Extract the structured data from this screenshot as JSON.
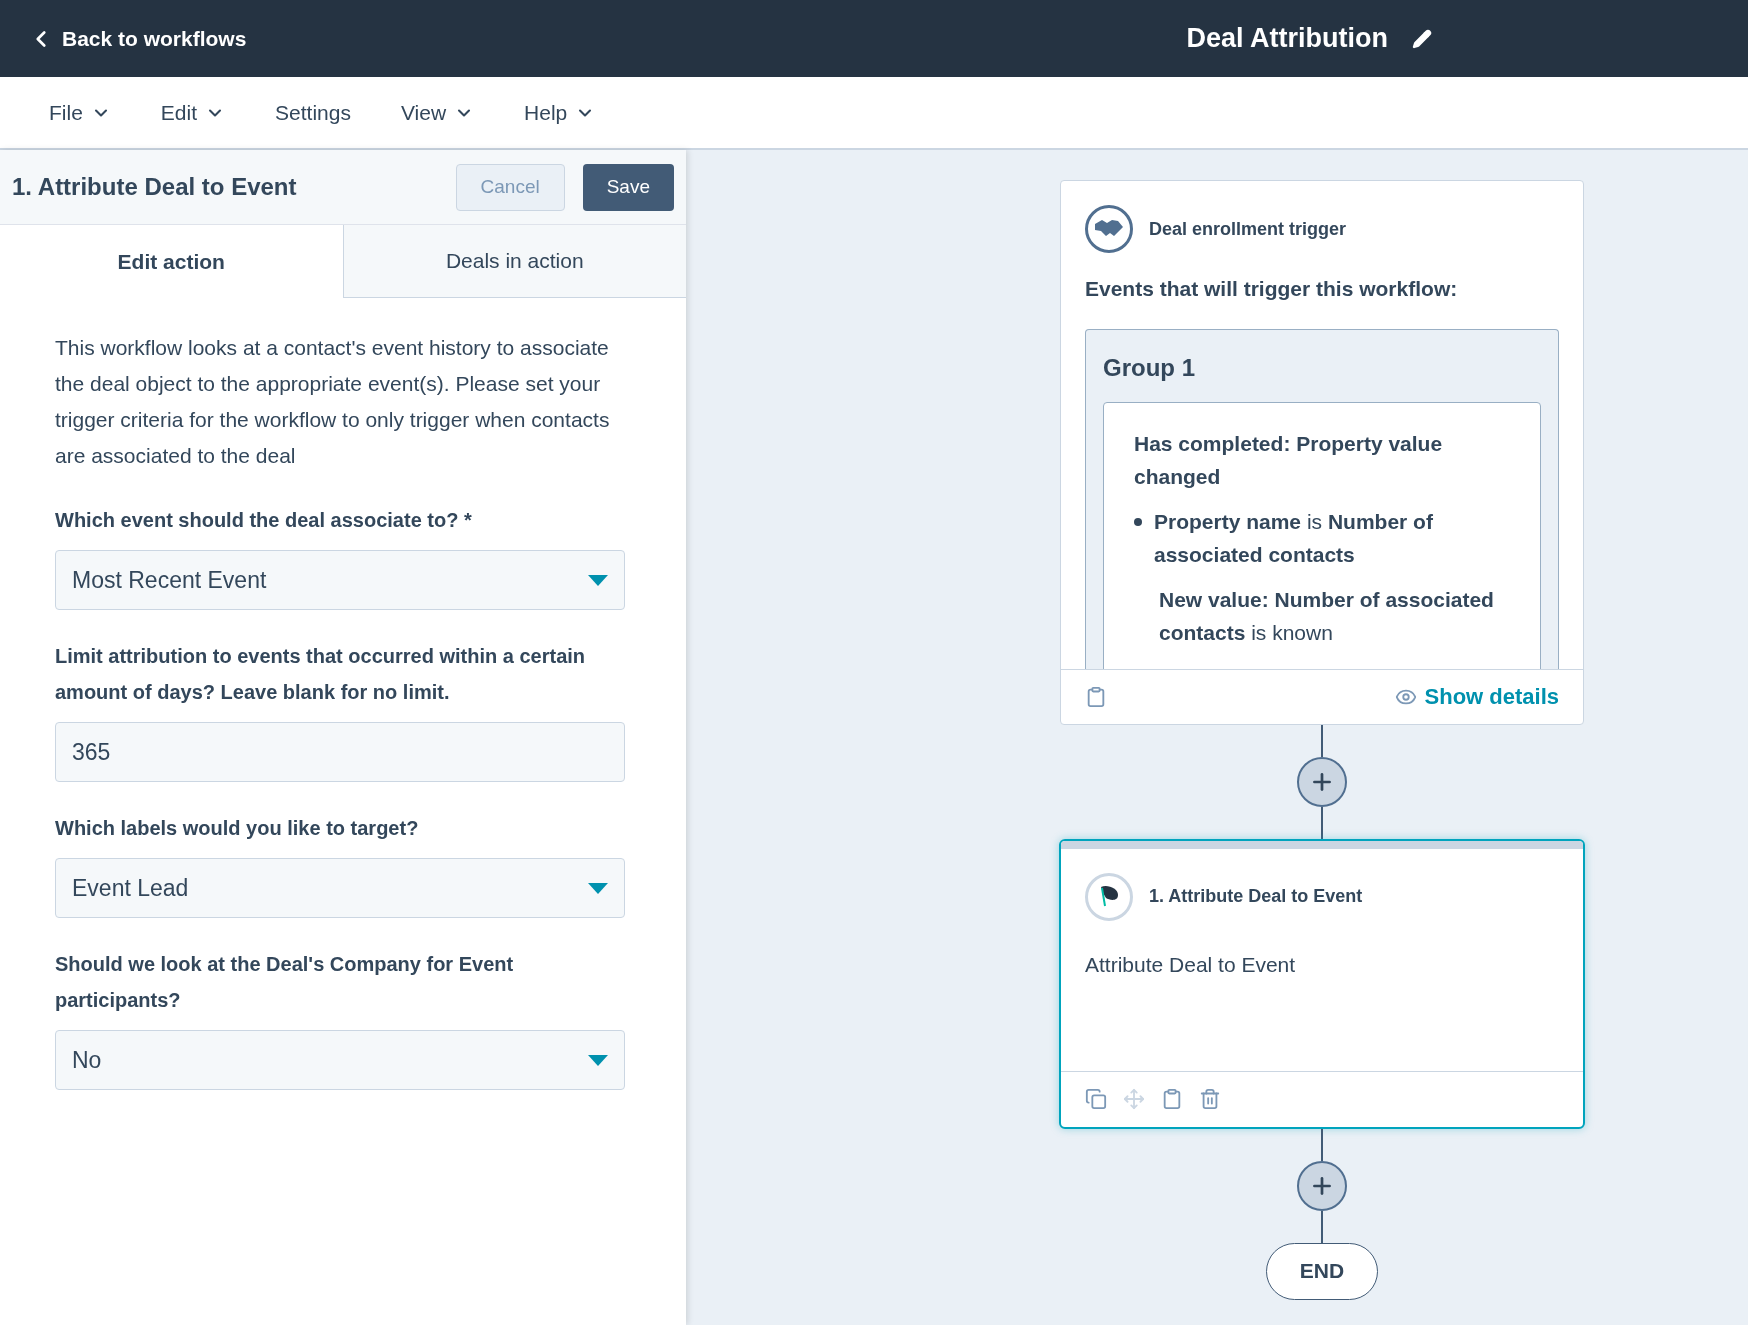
{
  "header": {
    "back_link": "Back to workflows",
    "title": "Deal Attribution"
  },
  "menu": [
    {
      "label": "File",
      "dropdown": true
    },
    {
      "label": "Edit",
      "dropdown": true
    },
    {
      "label": "Settings",
      "dropdown": false
    },
    {
      "label": "View",
      "dropdown": true
    },
    {
      "label": "Help",
      "dropdown": true
    }
  ],
  "panel": {
    "title": "1. Attribute Deal to Event",
    "cancel": "Cancel",
    "save": "Save",
    "tabs": [
      {
        "label": "Edit action",
        "selected": true
      },
      {
        "label": "Deals in action",
        "selected": false
      }
    ],
    "description": "This workflow looks at a contact's event history to associate the deal object to the appropriate event(s). Please set your trigger criteria for the workflow to only trigger when contacts are associated to the deal",
    "fields": [
      {
        "kind": "select",
        "label": "Which event should the deal associate to? *",
        "value": "Most Recent Event"
      },
      {
        "kind": "text",
        "label": "Limit attribution to events that occurred within a certain amount of days? Leave blank for no limit.",
        "value": "365"
      },
      {
        "kind": "select",
        "label": "Which labels would you like to target?",
        "value": "Event Lead"
      },
      {
        "kind": "select",
        "label": "Should we look at the Deal's Company for Event participants?",
        "value": "No"
      }
    ]
  },
  "trigger_card": {
    "title": "Deal enrollment trigger",
    "subtitle": "Events that will trigger this workflow:",
    "group": {
      "title": "Group 1",
      "heading": "Has completed: Property value changed",
      "bullets": [
        "**Property name** is **Number of associated contacts**"
      ],
      "note": "**New value: Number of associated contacts** is known"
    },
    "show_details": "Show details"
  },
  "action_card": {
    "title": "1. Attribute Deal to Event",
    "body": "Attribute Deal to Event",
    "tools": [
      {
        "kind": "copy",
        "disabled": false
      },
      {
        "kind": "move",
        "disabled": true
      },
      {
        "kind": "paste",
        "disabled": false
      },
      {
        "kind": "delete",
        "disabled": false
      }
    ]
  },
  "end_node": "END"
}
